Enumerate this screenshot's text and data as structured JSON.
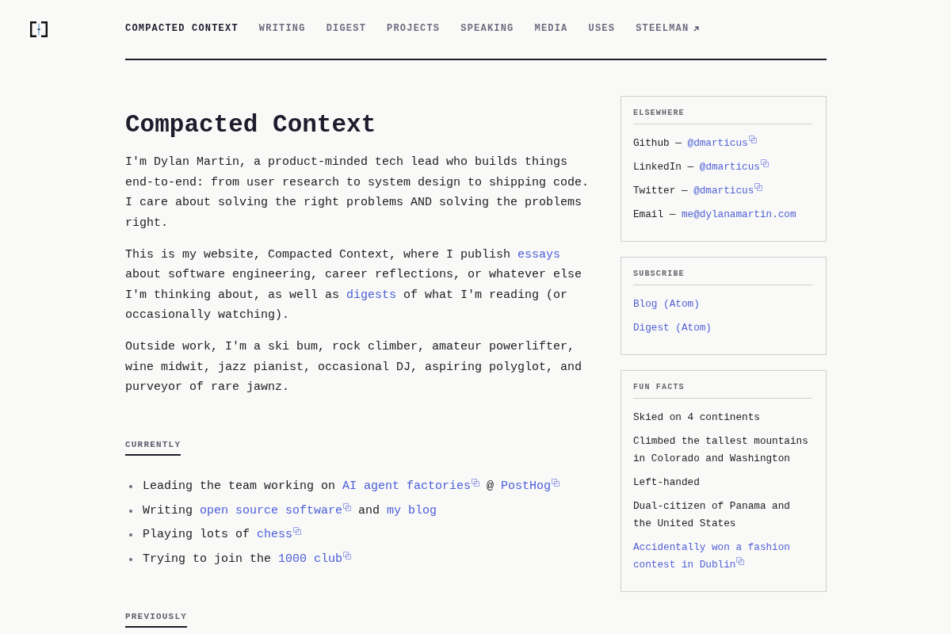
{
  "nav": [
    {
      "label": "COMPACTED CONTEXT",
      "selected": true,
      "external": false
    },
    {
      "label": "WRITING",
      "selected": false,
      "external": false
    },
    {
      "label": "DIGEST",
      "selected": false,
      "external": false
    },
    {
      "label": "PROJECTS",
      "selected": false,
      "external": false
    },
    {
      "label": "SPEAKING",
      "selected": false,
      "external": false
    },
    {
      "label": "MEDIA",
      "selected": false,
      "external": false
    },
    {
      "label": "USES",
      "selected": false,
      "external": false
    },
    {
      "label": "STEELMAN",
      "selected": false,
      "external": true
    }
  ],
  "heading": "Compacted Context",
  "intro": [
    {
      "parts": [
        {
          "kind": "text",
          "text": "I'm Dylan Martin, a product-minded tech lead who builds things end-to-end: from user research to system design to shipping code. I care about solving the right problems AND solving the problems right."
        }
      ]
    },
    {
      "parts": [
        {
          "kind": "text",
          "text": "This is my website, Compacted Context, where I publish "
        },
        {
          "kind": "link",
          "text": "essays",
          "external": false
        },
        {
          "kind": "text",
          "text": " about software engineering, career reflections, or whatever else I'm thinking about, as well as "
        },
        {
          "kind": "link",
          "text": "digests",
          "external": false
        },
        {
          "kind": "text",
          "text": " of what I'm reading (or occasionally watching)."
        }
      ]
    },
    {
      "parts": [
        {
          "kind": "text",
          "text": "Outside work, I'm a ski bum, rock climber, amateur powerlifter, wine midwit, jazz pianist, occasional DJ, aspiring polyglot, and purveyor of rare jawnz."
        }
      ]
    }
  ],
  "currently": {
    "title": "CURRENTLY",
    "items": [
      {
        "parts": [
          {
            "kind": "text",
            "text": "Leading the team working on "
          },
          {
            "kind": "link",
            "text": "AI agent factories",
            "external": true
          },
          {
            "kind": "text",
            "text": " @ "
          },
          {
            "kind": "link",
            "text": "PostHog",
            "external": true
          }
        ]
      },
      {
        "parts": [
          {
            "kind": "text",
            "text": "Writing "
          },
          {
            "kind": "link",
            "text": "open source software",
            "external": true
          },
          {
            "kind": "text",
            "text": " and "
          },
          {
            "kind": "link",
            "text": "my blog",
            "external": false
          }
        ]
      },
      {
        "parts": [
          {
            "kind": "text",
            "text": "Playing lots of "
          },
          {
            "kind": "link",
            "text": "chess",
            "external": true
          }
        ]
      },
      {
        "parts": [
          {
            "kind": "text",
            "text": "Trying to join the "
          },
          {
            "kind": "link",
            "text": "1000 club",
            "external": true
          }
        ]
      }
    ]
  },
  "previously": {
    "title": "PREVIOUSLY"
  },
  "sidebar": [
    {
      "title": "ELSEWHERE",
      "items": [
        {
          "parts": [
            {
              "kind": "text",
              "text": "Github — "
            },
            {
              "kind": "link",
              "text": "@dmarticus",
              "external": true
            }
          ]
        },
        {
          "parts": [
            {
              "kind": "text",
              "text": "LinkedIn — "
            },
            {
              "kind": "link",
              "text": "@dmarticus",
              "external": true
            }
          ]
        },
        {
          "parts": [
            {
              "kind": "text",
              "text": "Twitter — "
            },
            {
              "kind": "link",
              "text": "@dmarticus",
              "external": true
            }
          ]
        },
        {
          "parts": [
            {
              "kind": "text",
              "text": "Email — "
            },
            {
              "kind": "link",
              "text": "me@dylanamartin.com",
              "external": false
            }
          ]
        }
      ]
    },
    {
      "title": "SUBSCRIBE",
      "items": [
        {
          "parts": [
            {
              "kind": "link",
              "text": "Blog (Atom)",
              "external": false
            }
          ]
        },
        {
          "parts": [
            {
              "kind": "link",
              "text": "Digest (Atom)",
              "external": false
            }
          ]
        }
      ]
    },
    {
      "title": "FUN FACTS",
      "items": [
        {
          "parts": [
            {
              "kind": "text",
              "text": "Skied on 4 continents"
            }
          ]
        },
        {
          "parts": [
            {
              "kind": "text",
              "text": "Climbed the tallest mountains in Colorado and Washington"
            }
          ]
        },
        {
          "parts": [
            {
              "kind": "text",
              "text": "Left-handed"
            }
          ]
        },
        {
          "parts": [
            {
              "kind": "text",
              "text": "Dual-citizen of Panama and the United States"
            }
          ]
        },
        {
          "parts": [
            {
              "kind": "link",
              "text": "Accidentally won a fashion contest in Dublin",
              "external": true
            }
          ]
        }
      ]
    }
  ]
}
